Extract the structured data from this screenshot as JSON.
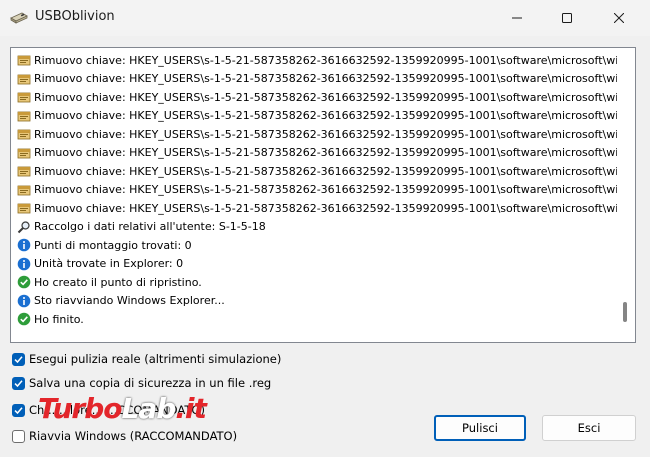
{
  "window": {
    "title": "USBOblivion"
  },
  "log": {
    "lines": [
      {
        "icon": "registry-icon",
        "text": "Rimuovo chiave: HKEY_USERS\\s-1-5-21-587358262-3616632592-1359920995-1001\\software\\microsoft\\wi..."
      },
      {
        "icon": "registry-icon",
        "text": "Rimuovo chiave: HKEY_USERS\\s-1-5-21-587358262-3616632592-1359920995-1001\\software\\microsoft\\wi..."
      },
      {
        "icon": "registry-icon",
        "text": "Rimuovo chiave: HKEY_USERS\\s-1-5-21-587358262-3616632592-1359920995-1001\\software\\microsoft\\wi..."
      },
      {
        "icon": "registry-icon",
        "text": "Rimuovo chiave: HKEY_USERS\\s-1-5-21-587358262-3616632592-1359920995-1001\\software\\microsoft\\wi..."
      },
      {
        "icon": "registry-icon",
        "text": "Rimuovo chiave: HKEY_USERS\\s-1-5-21-587358262-3616632592-1359920995-1001\\software\\microsoft\\wi..."
      },
      {
        "icon": "registry-icon",
        "text": "Rimuovo chiave: HKEY_USERS\\s-1-5-21-587358262-3616632592-1359920995-1001\\software\\microsoft\\wi..."
      },
      {
        "icon": "registry-icon",
        "text": "Rimuovo chiave: HKEY_USERS\\s-1-5-21-587358262-3616632592-1359920995-1001\\software\\microsoft\\wi..."
      },
      {
        "icon": "registry-icon",
        "text": "Rimuovo chiave: HKEY_USERS\\s-1-5-21-587358262-3616632592-1359920995-1001\\software\\microsoft\\wi..."
      },
      {
        "icon": "registry-icon",
        "text": "Rimuovo chiave: HKEY_USERS\\s-1-5-21-587358262-3616632592-1359920995-1001\\software\\microsoft\\wi..."
      },
      {
        "icon": "magnifier-icon",
        "text": "Raccolgo i dati relativi all'utente: S-1-5-18"
      },
      {
        "icon": "info-icon",
        "text": "Punti di montaggio trovati: 0"
      },
      {
        "icon": "info-icon",
        "text": "Unità trovate in Explorer: 0"
      },
      {
        "icon": "success-icon",
        "text": "Ho creato il punto di ripristino."
      },
      {
        "icon": "info-icon",
        "text": "Sto riavviando Windows Explorer..."
      },
      {
        "icon": "success-icon",
        "text": "Ho finito."
      }
    ]
  },
  "options": [
    {
      "label": "Esegui pulizia reale (altrimenti simulazione)",
      "checked": true
    },
    {
      "label": "Salva una copia di sicurezza in un file .reg",
      "checked": true
    },
    {
      "label": "Ch... ...lore... ...CCOMANDATO)",
      "checked": true
    },
    {
      "label": "Riavvia Windows (RACCOMANDATO)",
      "checked": false
    }
  ],
  "buttons": {
    "clean": "Pulisci",
    "exit": "Esci"
  },
  "watermark": {
    "part1": "Turbo",
    "part2": "Lab",
    "part3": ".it"
  },
  "colors": {
    "accent": "#005fb8",
    "success": "#2e9d3a",
    "info": "#1a6fd1",
    "watermark_red": "#e3262b"
  }
}
